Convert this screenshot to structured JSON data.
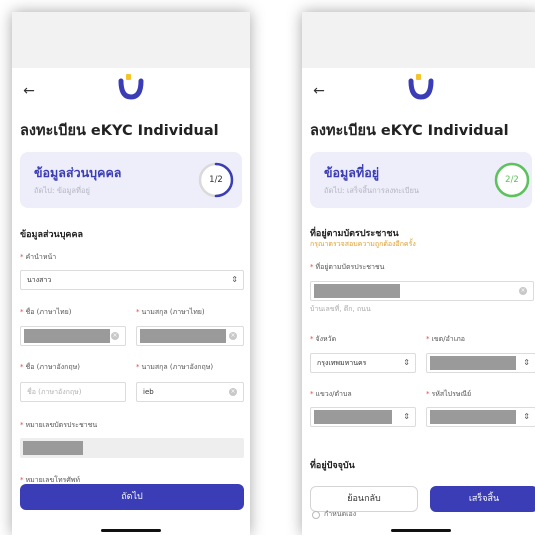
{
  "screen1": {
    "title": "ลงทะเบียน eKYC Individual",
    "step": {
      "title": "ข้อมูลส่วนบุคคล",
      "next": "ถัดไป: ข้อมูลที่อยู่",
      "progress_text": "1/2",
      "progress": 0.5
    },
    "section_title": "ข้อมูลส่วนบุคคล",
    "prefix": {
      "label": "คำนำหน้า",
      "value": "นางสาว"
    },
    "first_name_th": {
      "label": "ชื่อ (ภาษาไทย)"
    },
    "last_name_th": {
      "label": "นามสกุล (ภาษาไทย)"
    },
    "first_name_en": {
      "label": "ชื่อ (ภาษาอังกฤษ)",
      "placeholder": "ชื่อ (ภาษาอังกฤษ)"
    },
    "last_name_en": {
      "label": "นามสกุล (ภาษาอังกฤษ)",
      "value": "ieb"
    },
    "id_card": {
      "label": "หมายเลขบัตรประชาชน"
    },
    "phone": {
      "label": "หมายเลขโทรศัพท์"
    },
    "next_button": "ถัดไป"
  },
  "screen2": {
    "title": "ลงทะเบียน eKYC Individual",
    "step": {
      "title": "ข้อมูลที่อยู่",
      "next": "ถัดไป: เสร็จสิ้นการลงทะเบียน",
      "progress_text": "2/2",
      "progress": 1.0
    },
    "section_title": "ที่อยู่ตามบัตรประชาชน",
    "section_hint": "กรุณาตรวจสอบความถูกต้องอีกครั้ง",
    "address": {
      "label": "ที่อยู่ตามบัตรประชาชน",
      "helper": "บ้านเลขที่, ตึก, ถนน"
    },
    "province": {
      "label": "จังหวัด",
      "value": "กรุงเทพมหานคร"
    },
    "district": {
      "label": "เขต/อำเภอ"
    },
    "subdistrict": {
      "label": "แขวง/ตำบล"
    },
    "postcode": {
      "label": "รหัสไปรษณีย์"
    },
    "current_address_title": "ที่อยู่ปัจจุบัน",
    "custom_option": "กำหนดเอง",
    "back_button": "ย้อนกลับ",
    "finish_button": "เสร็จสิ้น"
  },
  "colors": {
    "brand_primary": "#3a3db5",
    "brand_yellow": "#f4c42a",
    "progress_green": "#5cc25c",
    "hint_orange": "#e0a02c",
    "required_red": "#e04848"
  },
  "icons": {
    "back": "arrow-left-icon",
    "clear": "clear-circle-icon",
    "select": "chevron-updown-icon"
  }
}
